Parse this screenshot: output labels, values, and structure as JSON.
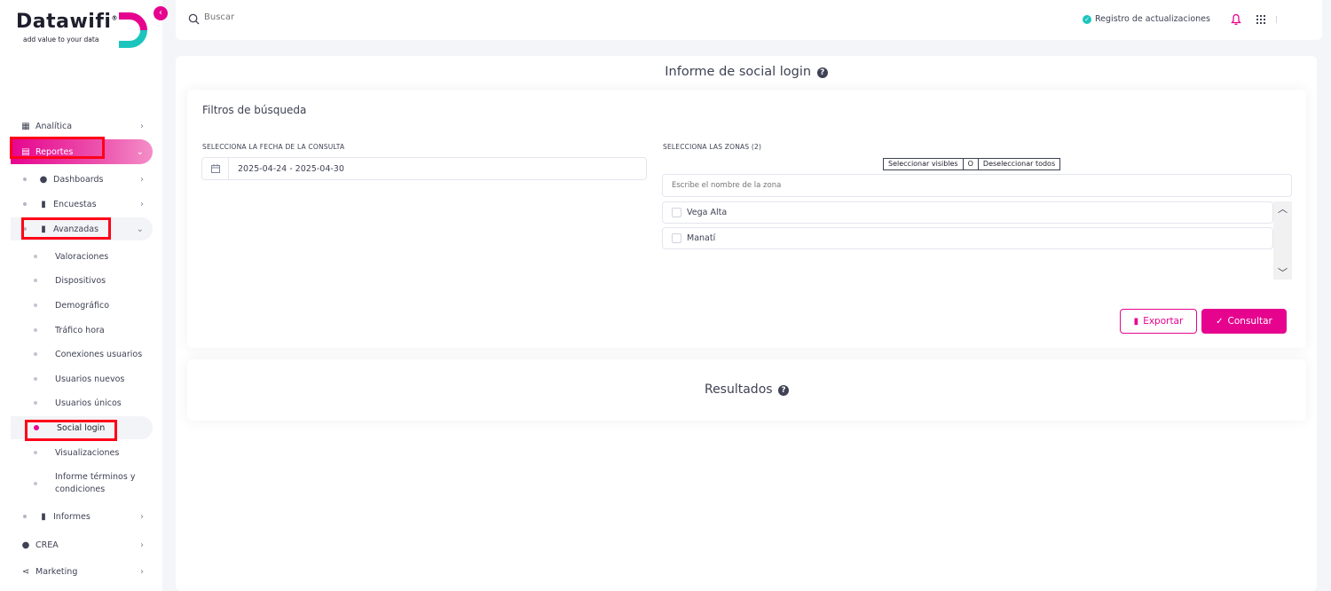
{
  "brand": {
    "name": "Datawifi",
    "registered": "®",
    "tagline": "add value to your data",
    "accent": "#e6048f",
    "secondary": "#1bc5bd"
  },
  "sidebar": {
    "collapse_icon": "chevron-left-icon",
    "items": {
      "analitica": {
        "label": "Analítica",
        "icon": "chart-box-icon"
      },
      "reportes": {
        "label": "Reportes",
        "icon": "document-icon"
      },
      "dashboards": {
        "label": "Dashboards",
        "icon": "palette-icon"
      },
      "encuestas": {
        "label": "Encuestas",
        "icon": "clipboard-icon"
      },
      "avanzadas": {
        "label": "Avanzadas",
        "icon": "bar-chart-icon"
      },
      "valoraciones": {
        "label": "Valoraciones"
      },
      "dispositivos": {
        "label": "Dispositivos"
      },
      "demografico": {
        "label": "Demográfico"
      },
      "trafico_hora": {
        "label": "Tráfico hora"
      },
      "conexiones_usuarios": {
        "label": "Conexiones usuarios"
      },
      "usuarios_nuevos": {
        "label": "Usuarios nuevos"
      },
      "usuarios_unicos": {
        "label": "Usuarios únicos"
      },
      "social_login": {
        "label": "Social login"
      },
      "visualizaciones": {
        "label": "Visualizaciones"
      },
      "informe_terminos_1": {
        "label": "Informe términos y"
      },
      "informe_terminos_2": {
        "label": "condiciones"
      },
      "informes": {
        "label": "Informes",
        "icon": "book-icon"
      },
      "crea": {
        "label": "CREA",
        "icon": "lightbulb-icon"
      },
      "marketing": {
        "label": "Marketing",
        "icon": "share-icon"
      }
    }
  },
  "topbar": {
    "search_placeholder": "Buscar",
    "changelog_label": "Registro de actualizaciones"
  },
  "page": {
    "title": "Informe de social login",
    "filters_title": "Filtros de búsqueda",
    "date_label": "SELECCIONA LA FECHA DE LA CONSULTA",
    "date_value": "2025-04-24 - 2025-04-30",
    "zones_label": "SELECCIONA LAS ZONAS (2)",
    "select_visible": "Seleccionar visibles",
    "or_label": "O",
    "deselect_all": "Deseleccionar todos",
    "zone_search_placeholder": "Escribe el nombre de la zona",
    "zones": [
      "Vega Alta",
      "Manatí"
    ],
    "export_label": "Exportar",
    "consult_label": "Consultar",
    "results_title": "Resultados"
  }
}
